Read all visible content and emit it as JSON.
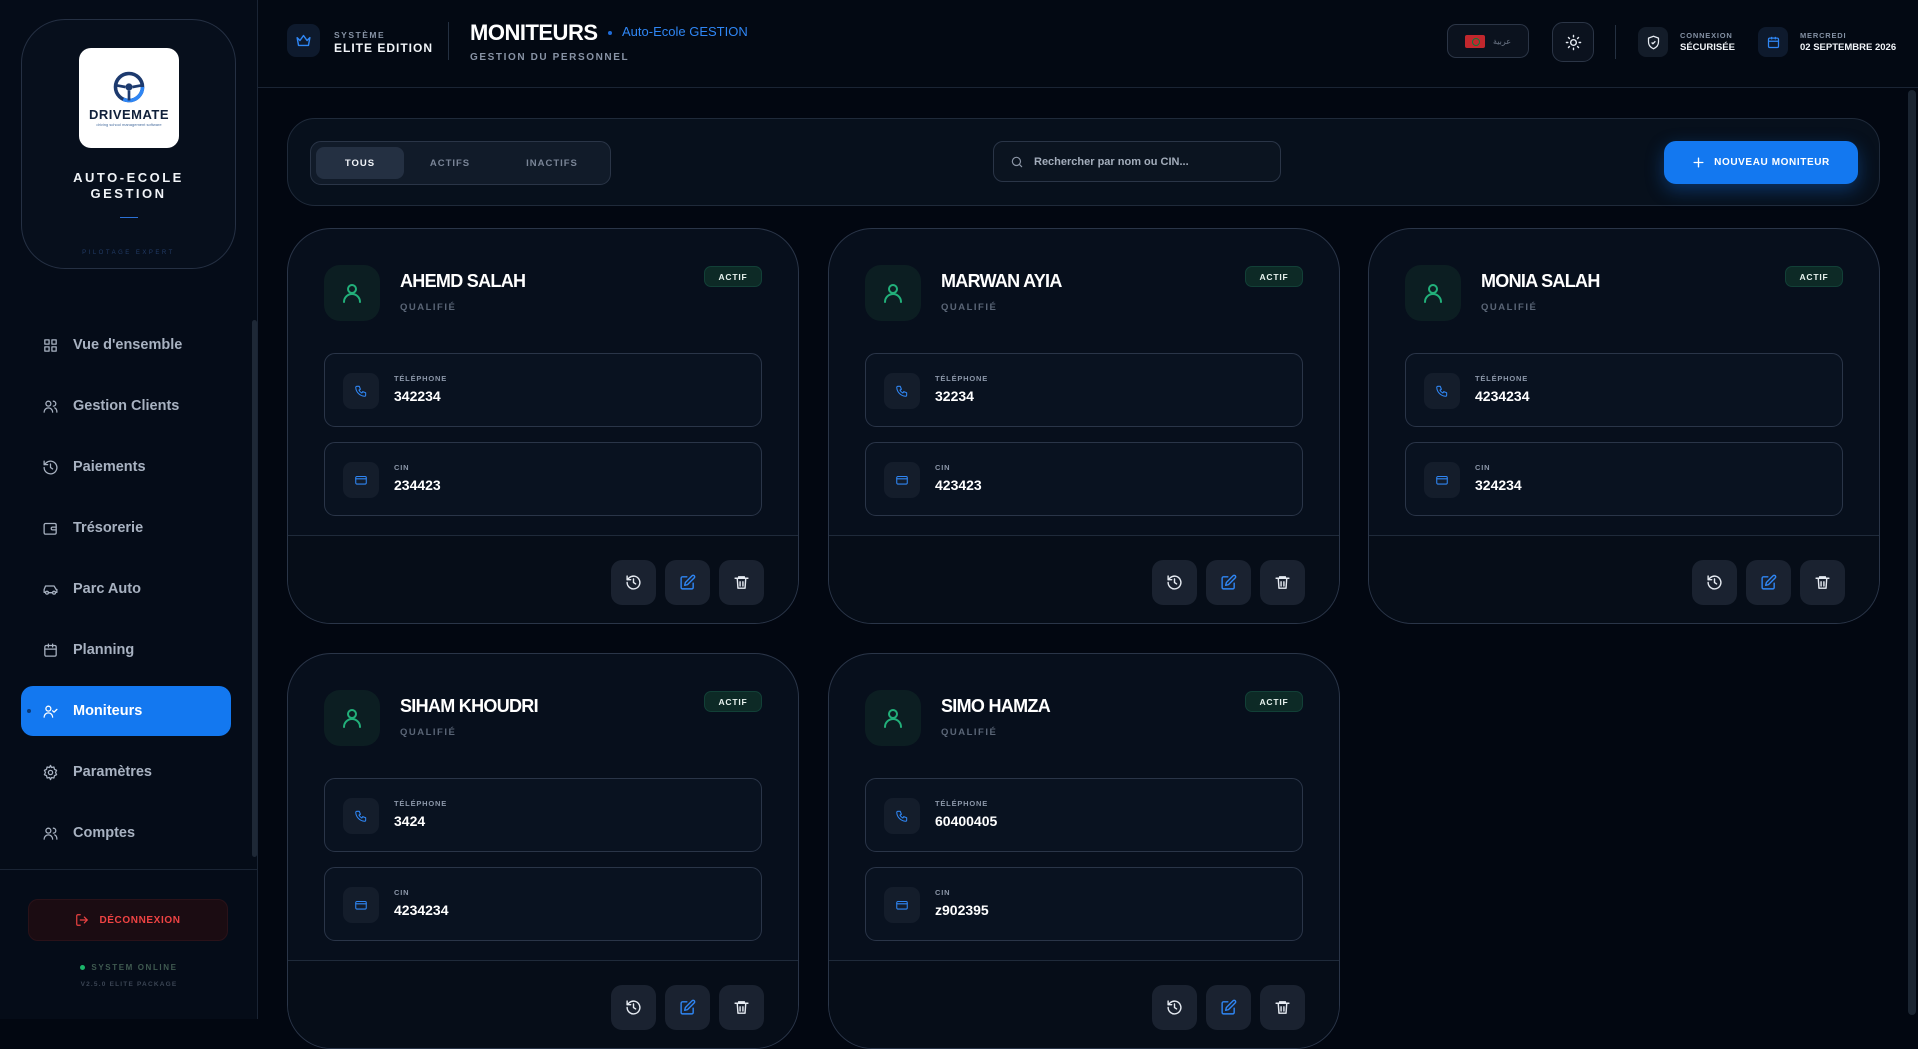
{
  "brand": {
    "logo_word": "DRIVEMATE",
    "logo_tagline": "driving school management software",
    "title_line1": "AUTO-ECOLE",
    "title_line2": "GESTION",
    "subtitle": "PILOTAGE EXPERT"
  },
  "nav": [
    {
      "label": "Vue d'ensemble",
      "icon": "dashboard-icon"
    },
    {
      "label": "Gestion Clients",
      "icon": "users-icon"
    },
    {
      "label": "Paiements",
      "icon": "history-icon"
    },
    {
      "label": "Trésorerie",
      "icon": "wallet-icon"
    },
    {
      "label": "Parc Auto",
      "icon": "car-icon"
    },
    {
      "label": "Planning",
      "icon": "calendar-icon"
    },
    {
      "label": "Moniteurs",
      "icon": "user-check-icon",
      "active": true
    },
    {
      "label": "Paramètres",
      "icon": "gear-icon"
    },
    {
      "label": "Comptes",
      "icon": "users-icon"
    }
  ],
  "sidebar_footer": {
    "logout": "DÉCONNEXION",
    "status": "SYSTEM ONLINE",
    "version": "V2.5.0 ELITE PACKAGE"
  },
  "header": {
    "system_label": "SYSTÈME",
    "system_value": "ELITE EDITION",
    "title": "MONITEURS",
    "breadcrumb": "Auto-Ecole GESTION",
    "subtitle": "GESTION DU PERSONNEL",
    "language": "عربية",
    "connection_label": "CONNEXION",
    "connection_value": "SÉCURISÉE",
    "day_label": "MERCREDI",
    "date_value": "02 SEPTEMBRE 2026"
  },
  "toolbar": {
    "filters": [
      "TOUS",
      "ACTIFS",
      "INACTIFS"
    ],
    "selected_filter": "TOUS",
    "search_placeholder": "Rechercher par nom ou CIN...",
    "add_button": "NOUVEAU MONITEUR"
  },
  "labels": {
    "qualification": "QUALIFIÉ",
    "phone": "TÉLÉPHONE",
    "cin": "CIN",
    "status": "ACTIF"
  },
  "moniteurs": [
    {
      "name": "AHEMD SALAH",
      "qualification": "QUALIFIÉ",
      "status": "ACTIF",
      "phone": "342234",
      "cin": "234423"
    },
    {
      "name": "MARWAN AYIA",
      "qualification": "QUALIFIÉ",
      "status": "ACTIF",
      "phone": "32234",
      "cin": "423423"
    },
    {
      "name": "MONIA SALAH",
      "qualification": "QUALIFIÉ",
      "status": "ACTIF",
      "phone": "4234234",
      "cin": "324234"
    },
    {
      "name": "SIHAM KHOUDRI",
      "qualification": "QUALIFIÉ",
      "status": "ACTIF",
      "phone": "3424",
      "cin": "4234234"
    },
    {
      "name": "SIMO HAMZA",
      "qualification": "QUALIFIÉ",
      "status": "ACTIF",
      "phone": "60400405",
      "cin": "z902395"
    }
  ],
  "colors": {
    "accent": "#1378f0",
    "success": "#22b07a",
    "danger": "#ef4343",
    "background": "#020711"
  }
}
